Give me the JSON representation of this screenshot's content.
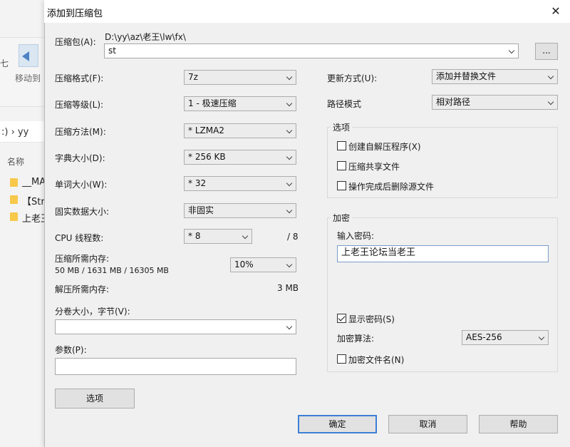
{
  "background": {
    "toolbar_move_label": "移动到",
    "toolbar_side_glyph": "七",
    "path_text": ":) › yy",
    "column_name": "名称",
    "files": [
      {
        "label": "__MA"
      },
      {
        "label": "【Str"
      },
      {
        "label": "上老王"
      }
    ]
  },
  "dialog": {
    "title": "添加到压缩包",
    "close_glyph": "✕",
    "archive": {
      "label": "压缩包(A):",
      "path": "D:\\yy\\az\\老王\\lw\\fx\\",
      "name": "st",
      "browse_label": "..."
    },
    "left": {
      "format": {
        "label": "压缩格式(F):",
        "value": "7z"
      },
      "level": {
        "label": "压缩等级(L):",
        "value": "1 - 极速压缩"
      },
      "method": {
        "label": "压缩方法(M):",
        "value": "* LZMA2"
      },
      "dict": {
        "label": "字典大小(D):",
        "value": "* 256 KB"
      },
      "word": {
        "label": "单词大小(W):",
        "value": "* 32"
      },
      "solid": {
        "label": "固实数据大小:",
        "value": "非固实"
      },
      "cpu": {
        "label": "CPU 线程数:",
        "value": "* 8",
        "max": "/ 8"
      },
      "mem_compress": {
        "label": "压缩所需内存:",
        "detail": "50 MB / 1631 MB / 16305 MB",
        "value": "10%"
      },
      "mem_decompress": {
        "label": "解压所需内存:",
        "value": "3 MB"
      },
      "volume": {
        "label": "分卷大小，字节(V):",
        "value": ""
      },
      "params": {
        "label": "参数(P):",
        "value": ""
      },
      "options_button": "选项"
    },
    "right": {
      "update": {
        "label": "更新方式(U):",
        "value": "添加并替换文件"
      },
      "pathmode": {
        "label": "路径模式",
        "value": "相对路径"
      },
      "options_group": {
        "title": "选项",
        "sfx": {
          "label": "创建自解压程序(X)",
          "checked": false
        },
        "shared": {
          "label": "压缩共享文件",
          "checked": false
        },
        "delete": {
          "label": "操作完成后删除源文件",
          "checked": false
        }
      },
      "encrypt_group": {
        "title": "加密",
        "password_label": "输入密码:",
        "password_value": "上老王论坛当老王",
        "show_password": {
          "label": "显示密码(S)",
          "checked": true
        },
        "algorithm_label": "加密算法:",
        "algorithm_value": "AES-256",
        "encrypt_names": {
          "label": "加密文件名(N)",
          "checked": false
        }
      }
    },
    "buttons": {
      "ok": "确定",
      "cancel": "取消",
      "help": "帮助"
    }
  }
}
